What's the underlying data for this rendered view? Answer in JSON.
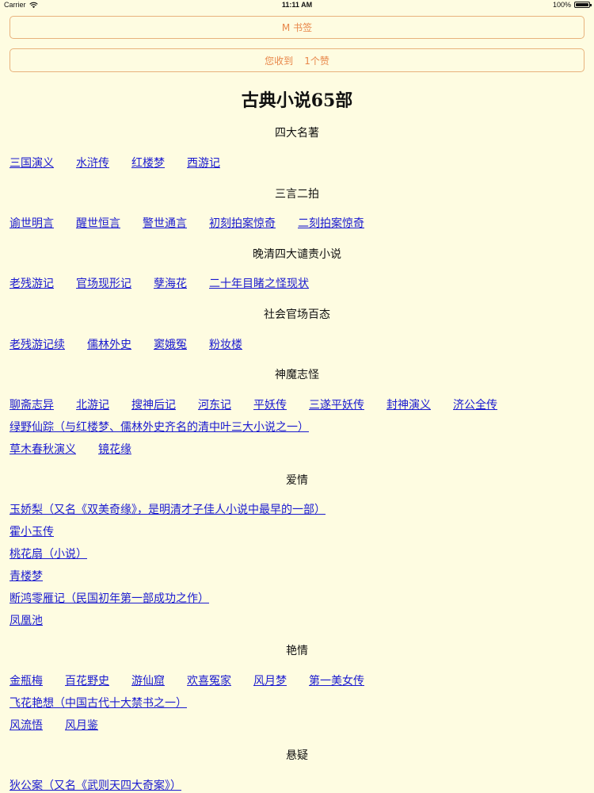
{
  "status": {
    "carrier": "Carrier",
    "time": "11:11 AM",
    "battery": "100%"
  },
  "buttons": {
    "bookmark": "M 书签",
    "likes_prefix": "您收到",
    "likes_suffix": "1个赞"
  },
  "title": "古典小说65部",
  "sections": [
    {
      "title": "四大名著",
      "rows": [
        [
          "三国演义",
          "水浒传",
          "红楼梦",
          "西游记"
        ]
      ]
    },
    {
      "title": "三言二拍",
      "rows": [
        [
          "谕世明言",
          "醒世恒言",
          "警世通言",
          "初刻拍案惊奇",
          "二刻拍案惊奇"
        ]
      ]
    },
    {
      "title": "晚清四大谴责小说",
      "rows": [
        [
          "老残游记",
          "官场现形记",
          "孽海花",
          "二十年目睹之怪现状"
        ]
      ]
    },
    {
      "title": "社会官场百态",
      "rows": [
        [
          "老残游记续",
          "儒林外史",
          "窦娥冤",
          "粉妆楼"
        ]
      ]
    },
    {
      "title": "神魔志怪",
      "rows": [
        [
          "聊斋志异",
          "北游记",
          "搜神后记",
          "河东记",
          "平妖传",
          "三遂平妖传",
          "封神演义",
          "济公全传"
        ],
        [
          "绿野仙踪（与红楼梦、儒林外史齐名的清中叶三大小说之一）"
        ],
        [
          "草木春秋演义",
          "镜花缘"
        ]
      ]
    },
    {
      "title": "爱情",
      "rows": [
        [
          "玉娇梨（又名《双美奇缘》，是明清才子佳人小说中最早的一部）"
        ],
        [
          "霍小玉传"
        ],
        [
          "桃花扇（小说）"
        ],
        [
          "青楼梦"
        ],
        [
          "断鸿零雁记（民国初年第一部成功之作）"
        ],
        [
          "凤凰池"
        ]
      ]
    },
    {
      "title": "艳情",
      "rows": [
        [
          "金瓶梅",
          "百花野史",
          "游仙窟",
          "欢喜冤家",
          "风月梦",
          "第一美女传"
        ],
        [
          "飞花艳想（中国古代十大禁书之一）"
        ],
        [
          "风流悟",
          "风月鉴"
        ]
      ]
    },
    {
      "title": "悬疑",
      "rows": [
        [
          "狄公案（又名《武则天四大奇案》）"
        ]
      ]
    }
  ]
}
